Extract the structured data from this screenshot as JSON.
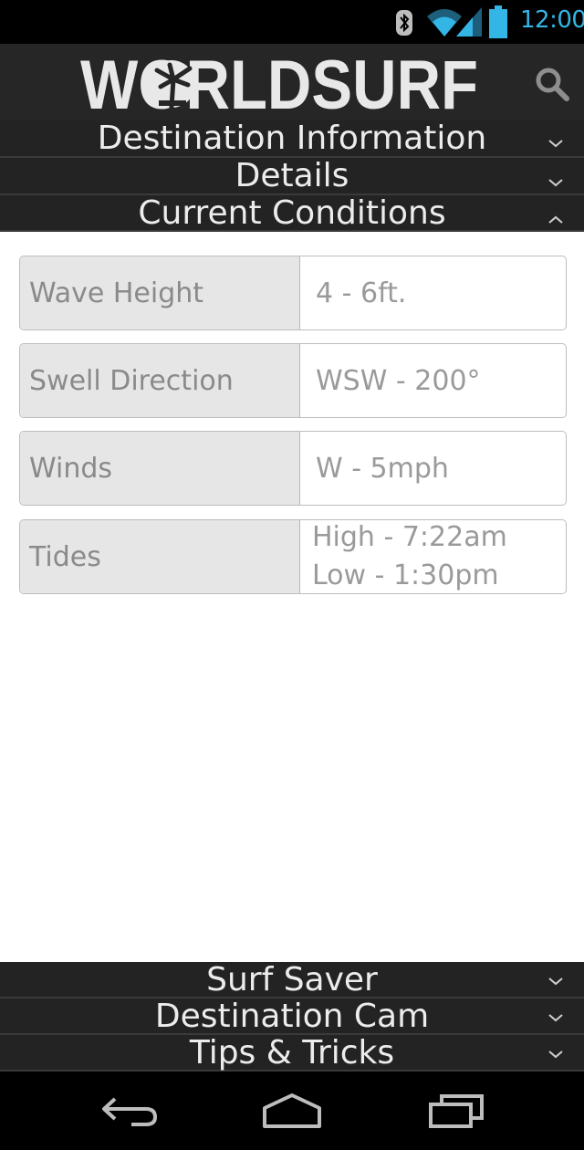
{
  "status_bar": {
    "time": "12:00",
    "accent_color": "#33b5e5",
    "icons": [
      "bluetooth-icon",
      "wifi-icon",
      "cell-signal-icon",
      "battery-icon"
    ]
  },
  "header": {
    "logo_text": "WORLDSURF",
    "search_icon": "search-icon"
  },
  "sections_top": [
    {
      "label": "Destination Information",
      "state": "collapsed"
    },
    {
      "label": "Details",
      "state": "collapsed"
    },
    {
      "label": "Current Conditions",
      "state": "expanded"
    }
  ],
  "conditions": [
    {
      "label": "Wave Height",
      "value": "4 - 6ft."
    },
    {
      "label": "Swell Direction",
      "value": "WSW - 200°"
    },
    {
      "label": "Winds",
      "value": "W - 5mph"
    },
    {
      "label": "Tides",
      "value_lines": [
        "High - 7:22am",
        "Low - 1:30pm"
      ]
    }
  ],
  "sections_bottom": [
    {
      "label": "Surf Saver",
      "state": "collapsed"
    },
    {
      "label": "Destination Cam",
      "state": "collapsed"
    },
    {
      "label": "Tips & Tricks",
      "state": "collapsed"
    }
  ],
  "nav_bar": {
    "icons": [
      "back-icon",
      "home-icon",
      "recent-apps-icon"
    ]
  }
}
